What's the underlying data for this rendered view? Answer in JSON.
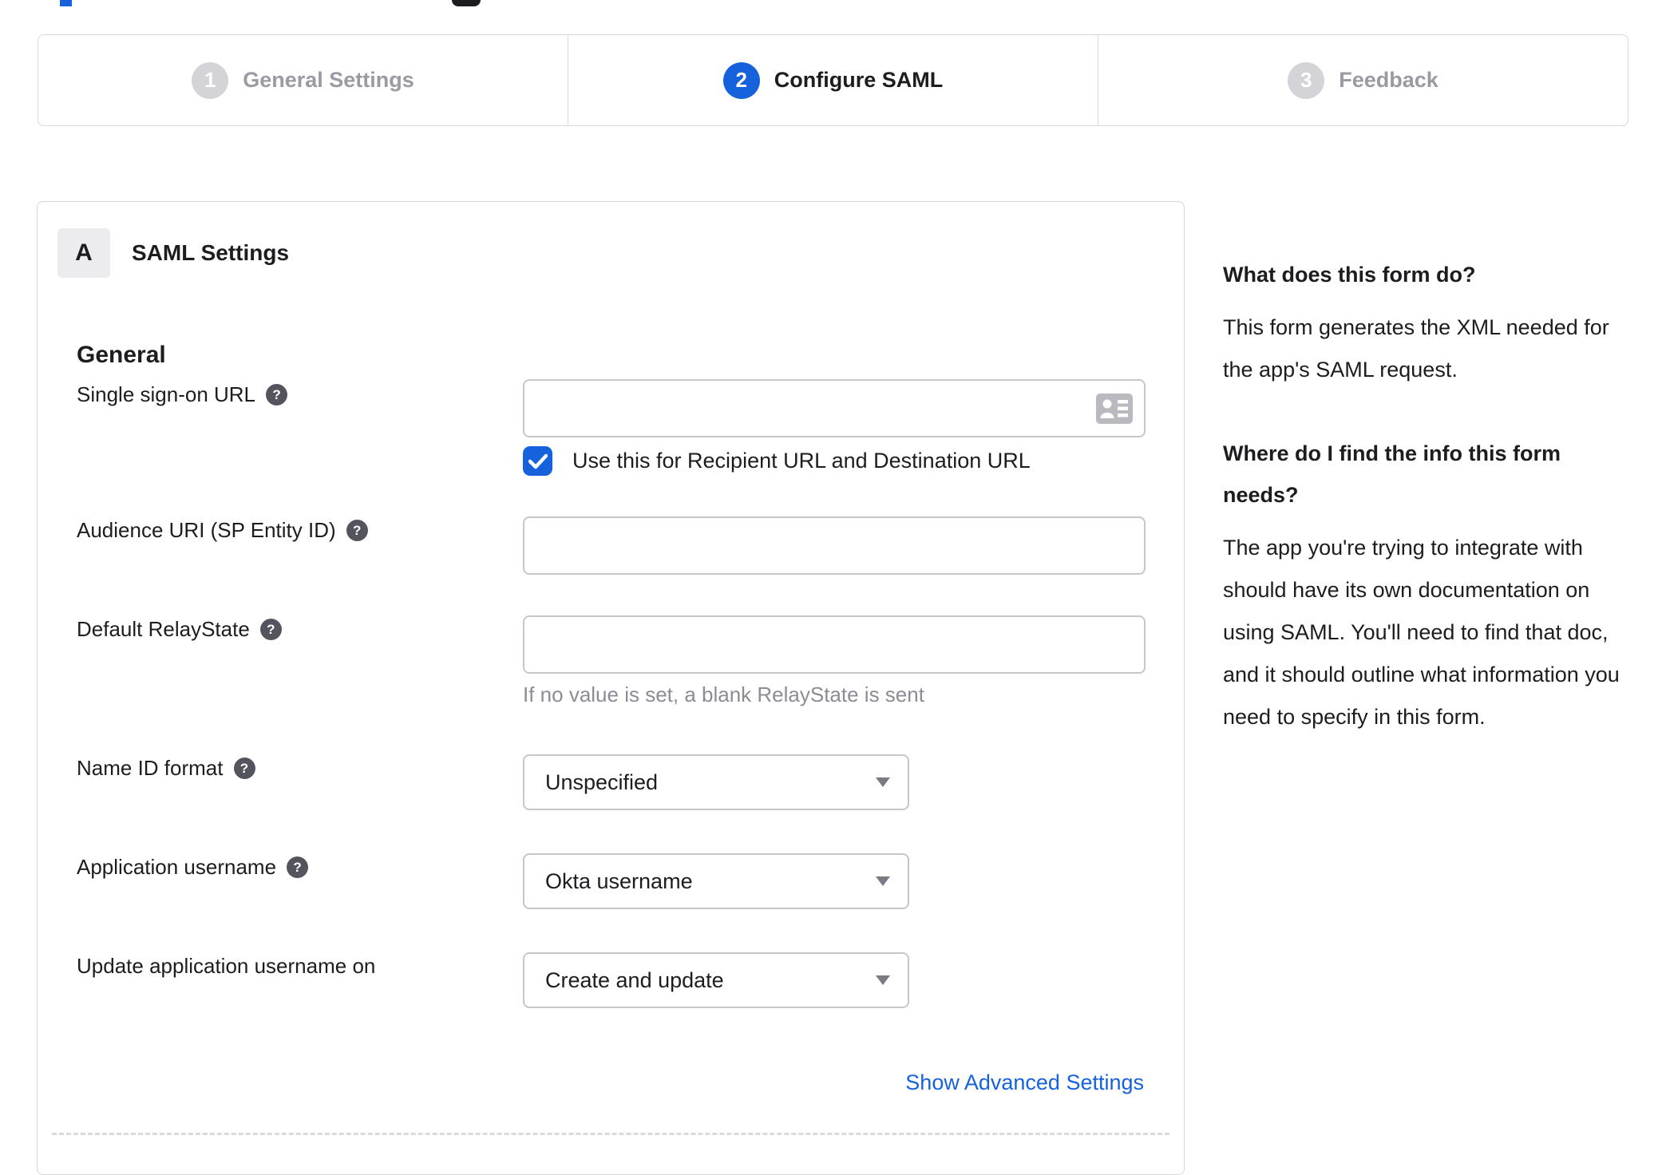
{
  "colors": {
    "accent_blue": "#1662dd",
    "text_dark": "#1d1d21",
    "text_gray": "#8c8c96",
    "border_gray": "#d7d7dc",
    "inactive_step_gray": "#d3d3d8",
    "icon_gray": "#b9b9bf"
  },
  "stepper": {
    "steps": [
      {
        "number": "1",
        "label": "General Settings",
        "state": "inactive"
      },
      {
        "number": "2",
        "label": "Configure SAML",
        "state": "active"
      },
      {
        "number": "3",
        "label": "Feedback",
        "state": "inactive"
      }
    ]
  },
  "panel": {
    "badge": "A",
    "title": "SAML Settings",
    "section_heading": "General",
    "advanced_link": "Show Advanced Settings"
  },
  "fields": {
    "sso_url": {
      "label": "Single sign-on URL",
      "value": "",
      "has_help": true,
      "checkbox_checked": true,
      "checkbox_label": "Use this for Recipient URL and Destination URL"
    },
    "audience_uri": {
      "label": "Audience URI (SP Entity ID)",
      "value": "",
      "has_help": true
    },
    "relay_state": {
      "label": "Default RelayState",
      "value": "",
      "has_help": true,
      "hint": "If no value is set, a blank RelayState is sent"
    },
    "name_id_format": {
      "label": "Name ID format",
      "value": "Unspecified",
      "has_help": true
    },
    "app_username": {
      "label": "Application username",
      "value": "Okta username",
      "has_help": true
    },
    "update_app_username": {
      "label": "Update application username on",
      "value": "Create and update",
      "has_help": false
    }
  },
  "sidebar": {
    "q1": "What does this form do?",
    "a1": "This form generates the XML needed for the app's SAML request.",
    "q2": "Where do I find the info this form needs?",
    "a2": "The app you're trying to integrate with should have its own documentation on using SAML. You'll need to find that doc, and it should outline what information you need to specify in this form."
  }
}
